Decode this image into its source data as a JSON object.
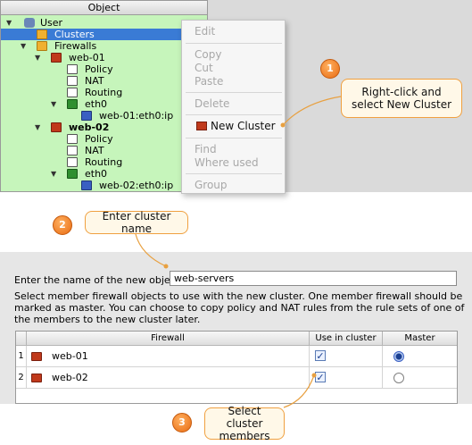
{
  "tree": {
    "header": "Object",
    "rows": [
      {
        "label": "User"
      },
      {
        "label": "Clusters"
      },
      {
        "label": "Firewalls"
      },
      {
        "label": "web-01"
      },
      {
        "label": "Policy"
      },
      {
        "label": "NAT"
      },
      {
        "label": "Routing"
      },
      {
        "label": "eth0"
      },
      {
        "label": "web-01:eth0:ip"
      },
      {
        "label": "web-02"
      },
      {
        "label": "Policy"
      },
      {
        "label": "NAT"
      },
      {
        "label": "Routing"
      },
      {
        "label": "eth0"
      },
      {
        "label": "web-02:eth0:ip"
      }
    ]
  },
  "context_menu": {
    "items": [
      {
        "label": "Edit",
        "enabled": false
      },
      {
        "label": "Copy",
        "enabled": false
      },
      {
        "label": "Cut",
        "enabled": false
      },
      {
        "label": "Paste",
        "enabled": false
      },
      {
        "label": "Delete",
        "enabled": false
      },
      {
        "label": "New Cluster",
        "enabled": true
      },
      {
        "label": "Find",
        "enabled": false
      },
      {
        "label": "Where used",
        "enabled": false
      },
      {
        "label": "Group",
        "enabled": false
      }
    ]
  },
  "callouts": {
    "step1": {
      "number": "1",
      "text": "Right-click and select New Cluster"
    },
    "step2": {
      "number": "2",
      "text": "Enter cluster name"
    },
    "step3": {
      "number": "3",
      "text": "Select cluster members"
    }
  },
  "dialog": {
    "name_label": "Enter the name of the new object",
    "name_value": "web-servers",
    "instructions": "Select member firewall objects to use with the new cluster. One member firewall should be marked as master. You can choose to copy policy and NAT rules from the rule sets of one of the members to the new cluster later.",
    "table": {
      "headers": {
        "firewall": "Firewall",
        "use": "Use in cluster",
        "master": "Master"
      },
      "rows": [
        {
          "num": "1",
          "firewall": "web-01",
          "use": true,
          "master": true
        },
        {
          "num": "2",
          "firewall": "web-02",
          "use": true,
          "master": false
        }
      ]
    }
  },
  "colors": {
    "tree_background": "#c6f5bb",
    "selection": "#3a7bd5",
    "callout_accent": "#e86b12"
  }
}
